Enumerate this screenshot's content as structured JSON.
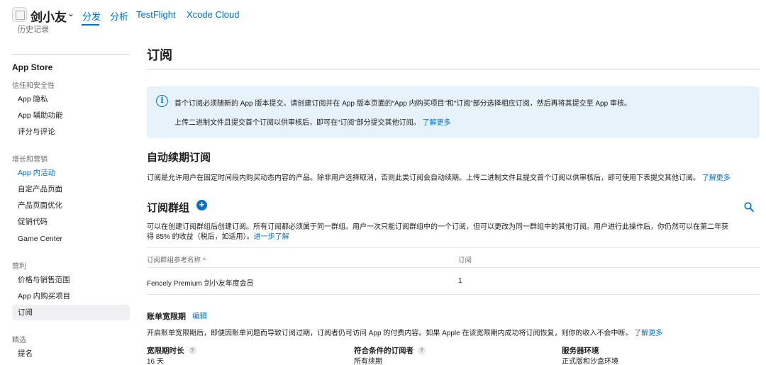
{
  "header": {
    "app_name": "剑小友",
    "tabs": [
      {
        "label": "分发"
      },
      {
        "label": "分析"
      },
      {
        "label": "TestFlight"
      },
      {
        "label": "Xcode Cloud"
      }
    ]
  },
  "sidebar": {
    "cut_off_item": "历史记录",
    "heading": "App Store",
    "groups": [
      {
        "label": "信任和安全性"
      },
      {
        "label": "增长和营销"
      },
      {
        "label": "营利"
      },
      {
        "label": "精选"
      }
    ],
    "items": [
      {
        "label": "App 隐私"
      },
      {
        "label": "App 辅助功能"
      },
      {
        "label": "评分与评论"
      },
      {
        "label": "App 内活动"
      },
      {
        "label": "自定产品页面"
      },
      {
        "label": "产品页面优化"
      },
      {
        "label": "促销代码"
      },
      {
        "label": "Game Center"
      },
      {
        "label": "价格与销售范围"
      },
      {
        "label": "App 内购买项目"
      },
      {
        "label": "订阅"
      },
      {
        "label": "提名"
      }
    ]
  },
  "main": {
    "title": "订阅",
    "notice": {
      "line1": "首个订阅必须随新的 App 版本提交。请创建订阅并在 App 版本页面的“App 内购买项目”和“订阅”部分选择相应订阅，然后再将其提交至 App 审核。",
      "line2": "上传二进制文件且提交首个订阅以供审核后，即可在“订阅”部分提交其他订阅。",
      "link": "了解更多"
    },
    "auto_renew": {
      "title": "自动续期订阅",
      "text": "订阅是允许用户在固定时间段内购买动态内容的产品。除非用户选择取消，否则此类订阅会自动续期。上传二进制文件且提交首个订阅以供审核后，即可使用下表提交其他订阅。",
      "link": "了解更多"
    },
    "groups": {
      "title": "订阅群组",
      "add_symbol": "+",
      "text1": "可以在创建订阅群组后创建订阅。所有订阅都必须属于同一群组。用户一次只能订阅群组中的一个订阅，但可以更改为同一群组中的其他订阅。用户进行此操作后，你仍然可以在第二年获",
      "text2": "得 85% 的收益（税后，如适用）。",
      "link": "进一步了解",
      "col_ref": "订阅群组参考名称",
      "sort_symbol": "^",
      "col_subs": "订阅",
      "row_name": "Fencely Premium 剑小友年度会员",
      "row_count": "1"
    },
    "grace": {
      "title": "账单宽限期",
      "edit": "编辑",
      "text": "开启账单宽限期后，即便因账单问题而导致订阅过期，订阅者仍可访问 App 的付费内容。如果 Apple 在该宽限期内成功将订阅恢复，则你的收入不会中断。",
      "link": "了解更多",
      "duration_label": "宽限期时长",
      "duration_value": "16 天",
      "eligible_label": "符合条件的订阅者",
      "eligible_value": "所有续期",
      "server_label": "服务器环境",
      "server_value": "正式版和沙盒环境",
      "help_symbol": "?"
    }
  },
  "colors": {
    "accent": "#0070c9",
    "notice_bg": "#e8f2fb",
    "selected_bg": "#f0f0f2"
  }
}
